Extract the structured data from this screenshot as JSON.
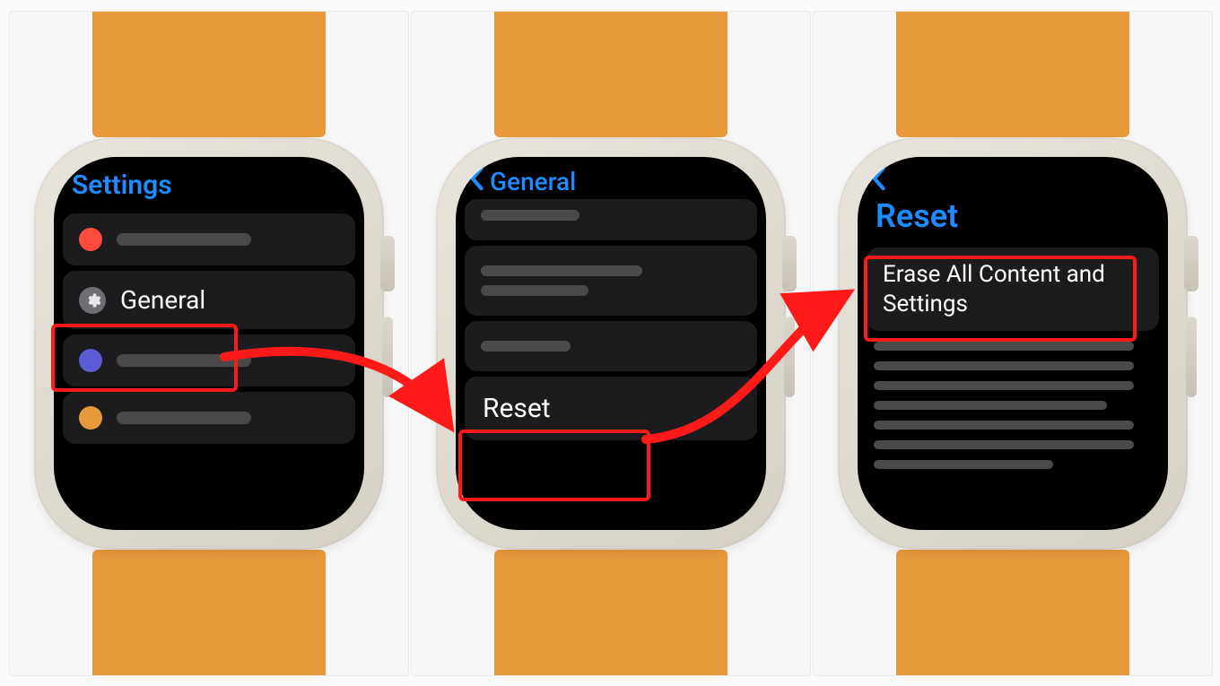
{
  "accent": "#1f8bff",
  "highlight": "#ff1a1a",
  "band_color": "#e79a3c",
  "screens": {
    "s1": {
      "title": "Settings",
      "general_label": "General",
      "dots": [
        "#ff4b3e",
        "#5b5bd6",
        "#e79a3c"
      ]
    },
    "s2": {
      "back_label": "General",
      "reset_label": "Reset"
    },
    "s3": {
      "back_label": "",
      "title": "Reset",
      "erase_label": "Erase All Content and Settings"
    }
  }
}
